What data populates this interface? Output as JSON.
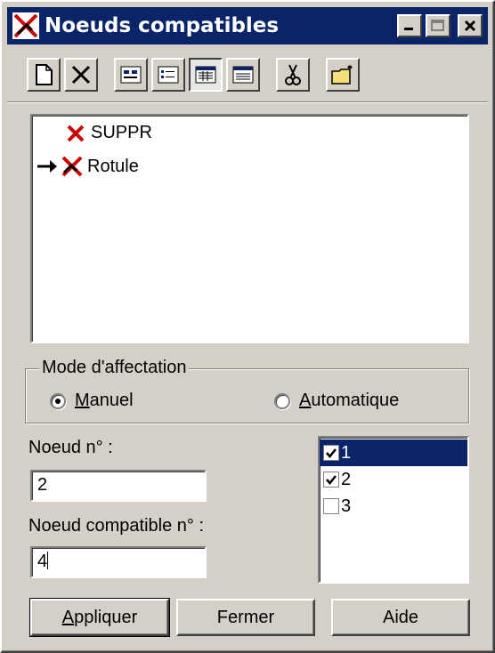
{
  "window": {
    "title": "Noeuds compatibles"
  },
  "toolbar": {
    "items": [
      "new-icon",
      "delete-icon",
      "view-details-icon",
      "view-list-icon",
      "view-grid-icon",
      "view-table-icon",
      "cut-icon",
      "open-folder-icon"
    ],
    "pressed": "view-grid-icon"
  },
  "tree": {
    "items": [
      {
        "label": "SUPPR",
        "icon": "delete-x-icon"
      },
      {
        "label": "Rotule",
        "icon": "hinge-node-icon",
        "current": true
      }
    ]
  },
  "mode": {
    "label": "Mode d'affectation",
    "options": [
      {
        "mnemonic": "M",
        "rest": "anuel",
        "selected": true
      },
      {
        "mnemonic": "A",
        "rest": "utomatique",
        "selected": false
      }
    ]
  },
  "fields": {
    "node_label": "Noeud n° :",
    "node_value": "2",
    "compat_label": "Noeud compatible n° :",
    "compat_value": "4"
  },
  "list": {
    "items": [
      {
        "label": "1",
        "checked": true,
        "selected": true
      },
      {
        "label": "2",
        "checked": true,
        "selected": false
      },
      {
        "label": "3",
        "checked": false,
        "selected": false
      }
    ]
  },
  "buttons": {
    "apply_mnemonic": "A",
    "apply_rest": "ppliquer",
    "close": "Fermer",
    "help": "Aide"
  },
  "colors": {
    "titlebar": "#0a246a",
    "face": "#d4d0c8",
    "accent_red": "#cc0000"
  }
}
